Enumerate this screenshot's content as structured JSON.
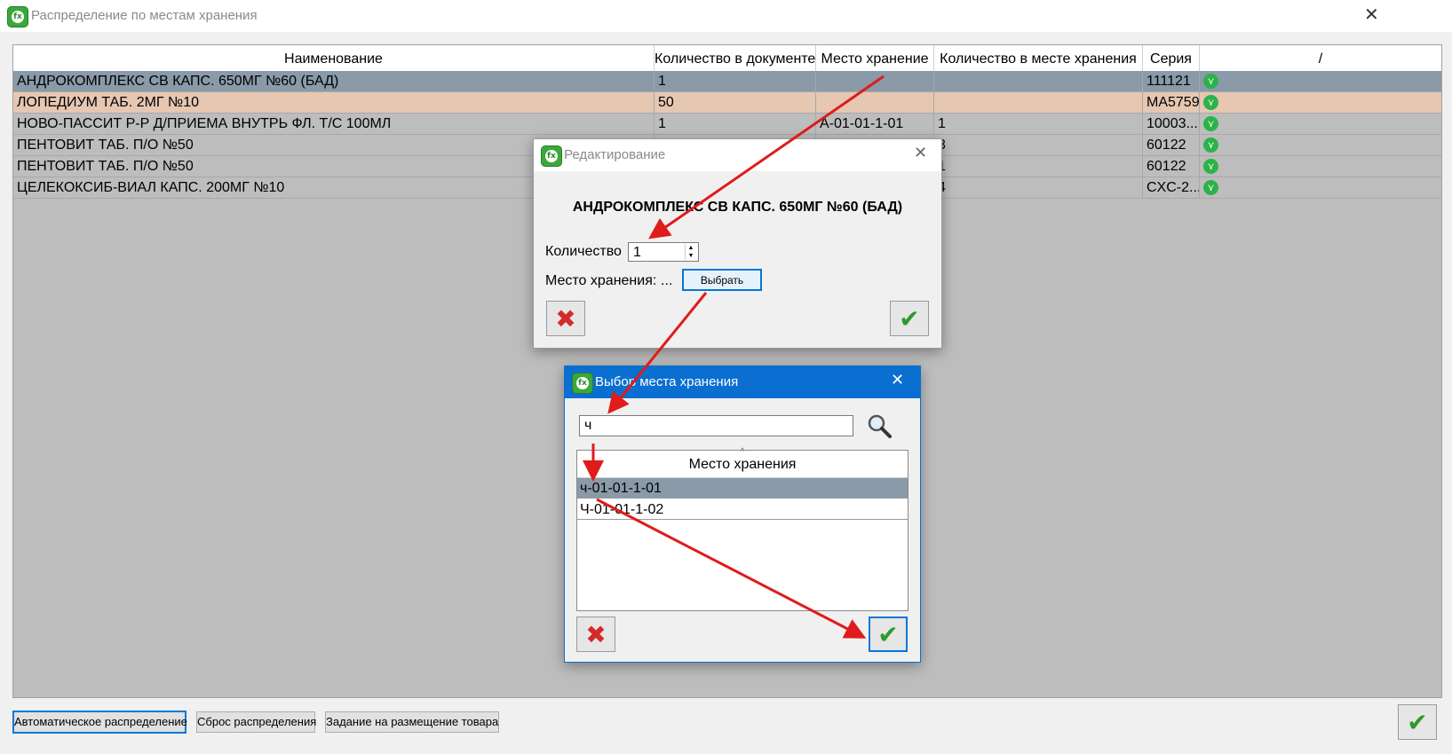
{
  "window": {
    "title": "Распределение по местам хранения"
  },
  "table": {
    "columns": [
      "Наименование",
      "Количество в документе",
      "Место хранение",
      "Количество в месте хранения",
      "Серия",
      "/"
    ],
    "rows": [
      {
        "name": "АНДРОКОМПЛЕКС СВ КАПС. 650МГ №60 (БАД)",
        "qty_doc": "1",
        "place": "",
        "qty_place": "",
        "series": "111121"
      },
      {
        "name": "ЛОПЕДИУМ ТАБ. 2МГ №10",
        "qty_doc": "50",
        "place": "",
        "qty_place": "",
        "series": "MA5759"
      },
      {
        "name": "НОВО-ПАССИТ Р-Р Д/ПРИЕМА ВНУТРЬ ФЛ. Т/С 100МЛ",
        "qty_doc": "1",
        "place": "А-01-01-1-01",
        "qty_place": "1",
        "series": "10003..."
      },
      {
        "name": "ПЕНТОВИТ ТАБ. П/О №50",
        "qty_doc": "",
        "place": "",
        "qty_place": "3",
        "series": "60122"
      },
      {
        "name": "ПЕНТОВИТ ТАБ. П/О №50",
        "qty_doc": "",
        "place": "",
        "qty_place": "1",
        "series": "60122"
      },
      {
        "name": "ЦЕЛЕКОКСИБ-ВИАЛ КАПС. 200МГ №10",
        "qty_doc": "",
        "place": "",
        "qty_place": "4",
        "series": "CXC-2..."
      }
    ],
    "row_colors": {
      "selected": "#8a9aa8",
      "highlight": "#e6c7b2",
      "normal": "#bdbdbd"
    }
  },
  "bottom": {
    "auto_label": "Автоматическое распределение",
    "reset_label": "Сброс распределения",
    "task_label": "Задание на размещение товара"
  },
  "edit_dialog": {
    "title": "Редактирование",
    "product": "АНДРОКОМПЛЕКС СВ КАПС. 650МГ №60 (БАД)",
    "qty_label": "Количество",
    "qty_value": "1",
    "place_label": "Место хранения:",
    "place_value": "...",
    "choose_label": "Выбрать"
  },
  "select_dialog": {
    "title": "Выбор места хранения",
    "search_value": "ч",
    "list_header": "Место хранения",
    "items": [
      "ч-01-01-1-01",
      "Ч-01-01-1-02"
    ],
    "title_bar_color": "#0a6fd0"
  },
  "icons": {
    "app": "app-logo-icon",
    "status": "status-ok-icon",
    "search": "magnifier-icon"
  }
}
